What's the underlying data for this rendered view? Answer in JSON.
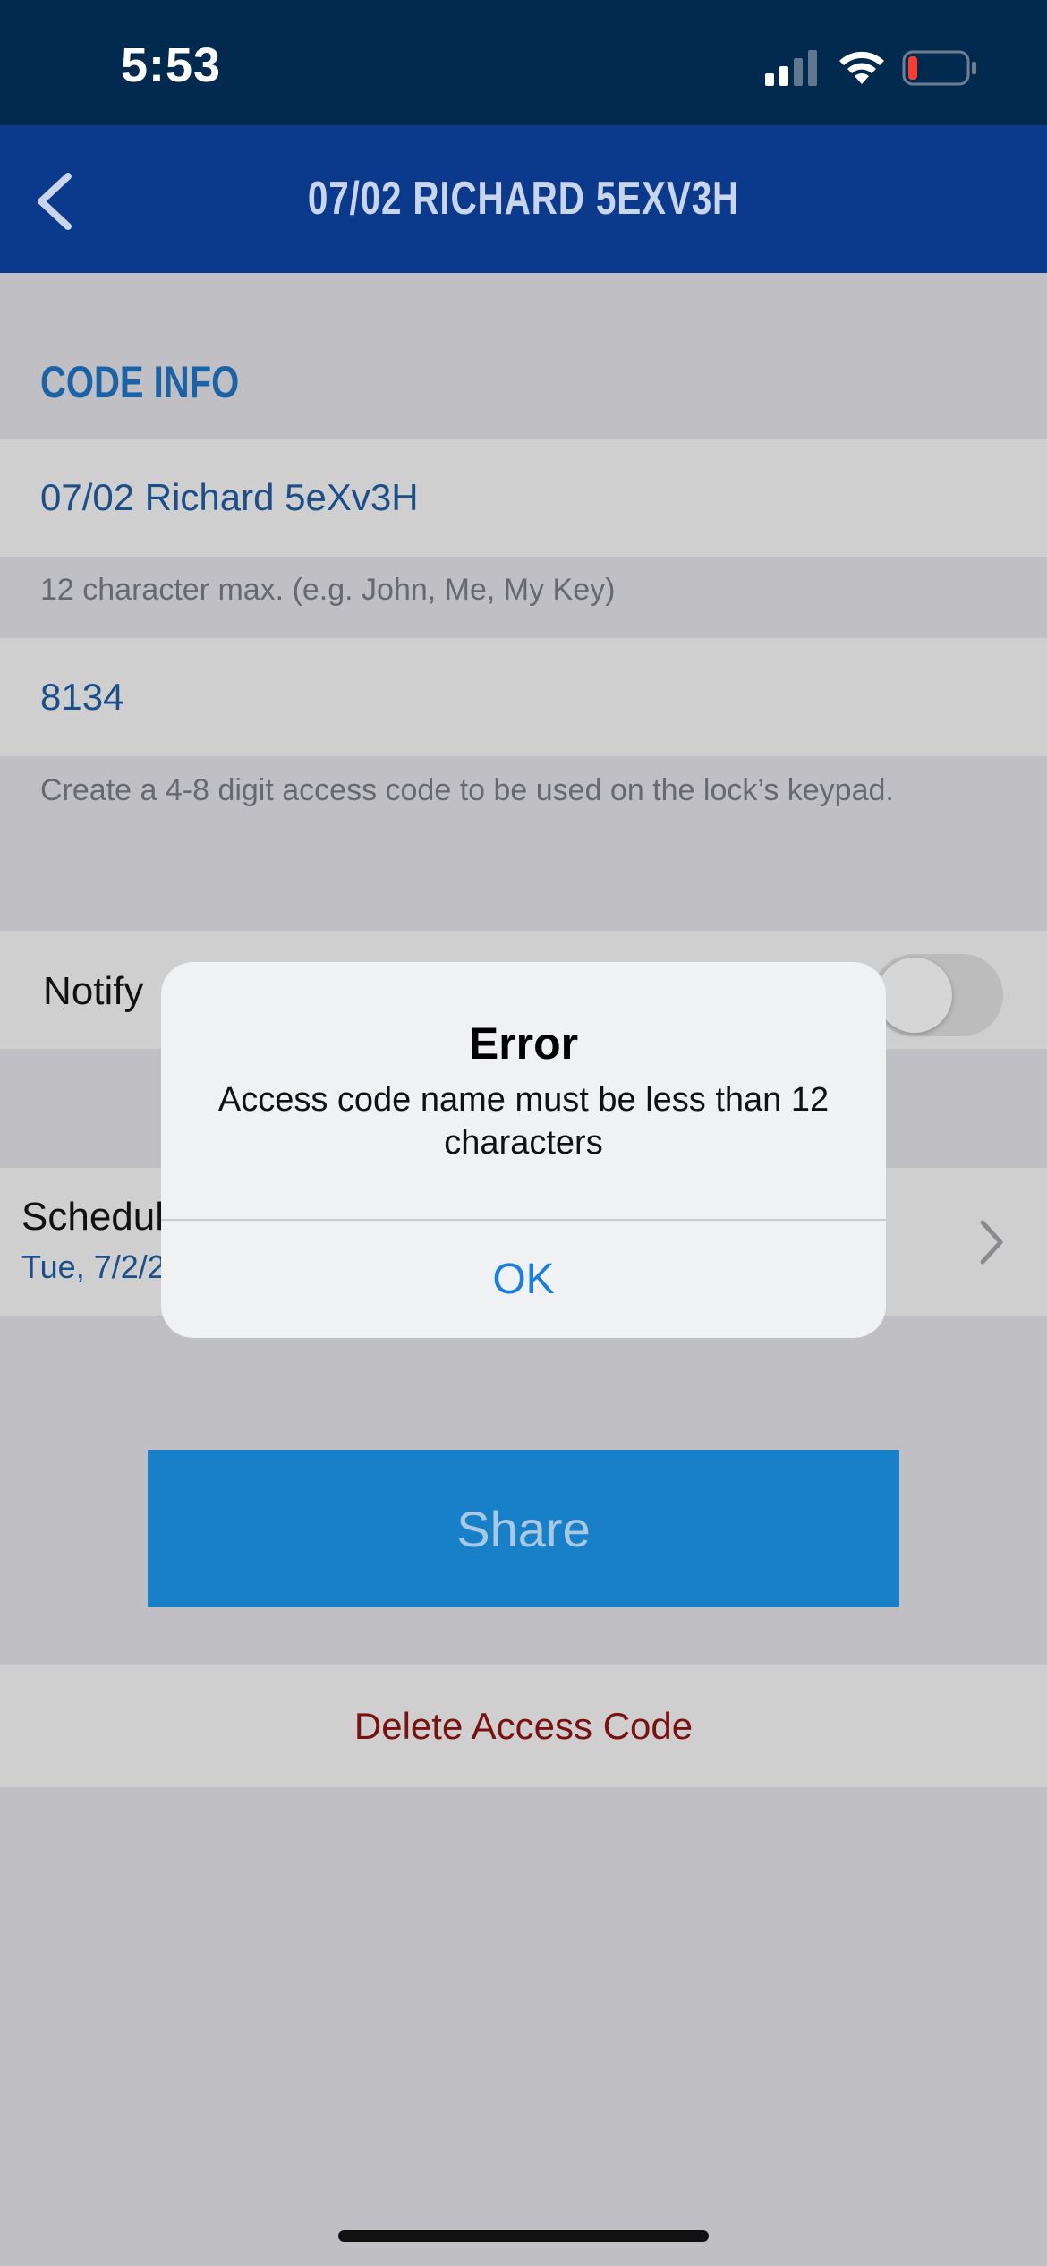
{
  "status_bar": {
    "time": "5:53",
    "icons": [
      "cellular-signal-icon",
      "wifi-icon",
      "battery-low-icon"
    ]
  },
  "nav": {
    "back_icon": "chevron-left-icon",
    "title": "07/02 RICHARD 5EXV3H"
  },
  "code_info": {
    "header": "CODE INFO",
    "name_value": "07/02 Richard 5eXv3H",
    "name_helper": "12 character max. (e.g. John, Me, My Key)",
    "code_value": "8134",
    "code_helper": "Create a 4-8 digit access code to be used on the lock’s keypad."
  },
  "notify": {
    "label": "Notify",
    "toggle_on": false
  },
  "schedule": {
    "label": "Schedul",
    "value": "Tue, 7/2/2",
    "chevron_icon": "chevron-right-icon"
  },
  "actions": {
    "share_label": "Share",
    "delete_label": "Delete Access Code"
  },
  "alert": {
    "title": "Error",
    "message": "Access code name must be less than 12 characters",
    "ok_label": "OK"
  },
  "colors": {
    "status_bar_bg": "#022a4f",
    "nav_bg": "#0b3a8c",
    "accent_blue": "#1780c9",
    "delete_red": "#7a1010",
    "alert_button_blue": "#1a7ee0"
  }
}
